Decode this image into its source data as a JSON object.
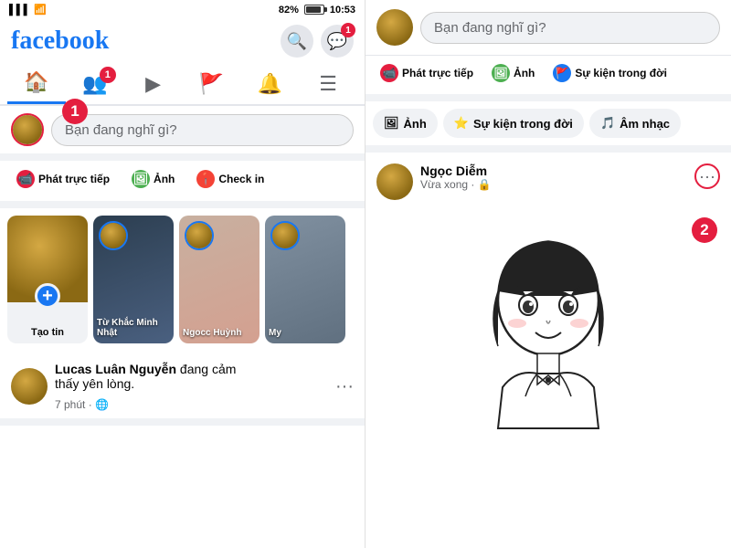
{
  "left": {
    "status_bar": {
      "signal": "▌▌▌",
      "wifi": "WiFi",
      "battery_pct": "82%",
      "time": "10:53"
    },
    "logo": "facebook",
    "nav": {
      "search_label": "🔍",
      "messenger_label": "💬",
      "messenger_badge": "1"
    },
    "tabs": [
      {
        "icon": "🏠",
        "active": true,
        "badge": null
      },
      {
        "icon": "👥",
        "active": false,
        "badge": "1"
      },
      {
        "icon": "▶",
        "active": false,
        "badge": null
      },
      {
        "icon": "🚩",
        "active": false,
        "badge": null
      },
      {
        "icon": "🔔",
        "active": false,
        "badge": null
      },
      {
        "icon": "☰",
        "active": false,
        "badge": null
      }
    ],
    "post_input": {
      "placeholder": "Bạn đang nghĩ gì?"
    },
    "actions": [
      {
        "label": "Phát trực tiếp",
        "icon": "📹",
        "color": "#e41e3f"
      },
      {
        "label": "Ảnh",
        "icon": "🖼",
        "color": "#4caf50"
      },
      {
        "label": "Check in",
        "icon": "📍",
        "color": "#f44336"
      }
    ],
    "stories": [
      {
        "type": "create",
        "label": "Tạo tin"
      },
      {
        "type": "user",
        "name": "Từ Khắc Minh Nhật",
        "bg": "dark"
      },
      {
        "type": "user",
        "name": "Ngocc Huỳnh",
        "bg": "warm"
      },
      {
        "type": "user",
        "name": "My",
        "bg": "cool"
      }
    ],
    "feed": [
      {
        "user": "Lucas Luân Nguyễn",
        "action": "đang cảm",
        "status": "thấy yên lòng.",
        "time": "7 phút",
        "privacy": "🌐"
      }
    ]
  },
  "right": {
    "post_input": {
      "placeholder": "Bạn đang nghĩ gì?"
    },
    "action_buttons": [
      {
        "label": "Phát trực tiếp",
        "icon": "📹",
        "color": "#e41e3f"
      },
      {
        "label": "Ảnh",
        "icon": "🖼",
        "color": "#4caf50"
      },
      {
        "label": "Sự kiện trong đời",
        "icon": "🚩",
        "color": "#1877f2"
      }
    ],
    "quick_actions": [
      {
        "label": "Ảnh",
        "icon": "🖼"
      },
      {
        "label": "Sự kiện trong đời",
        "icon": "⭐"
      },
      {
        "label": "Âm nhạc",
        "icon": "🎵"
      }
    ],
    "post": {
      "user": "Ngọc Diễm",
      "meta": "Vừa xong · 🔒",
      "menu": "···"
    },
    "tutorial_numbers": {
      "num1": "1",
      "num2": "2"
    }
  }
}
